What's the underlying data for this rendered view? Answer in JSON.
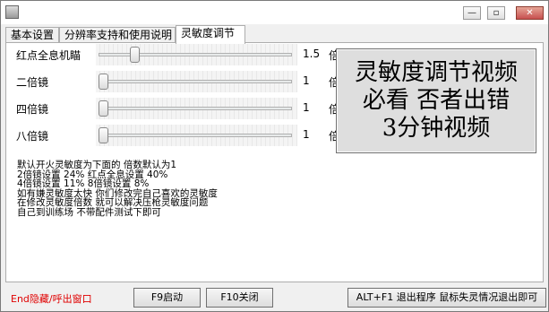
{
  "window": {
    "buttons": {
      "minimize": "—",
      "maximize": "▫",
      "close": "✕"
    }
  },
  "tabs": [
    "基本设置",
    "分辨率支持和使用说明",
    "灵敏度调节"
  ],
  "sliders": [
    {
      "label": "红点全息机瞄",
      "value": "1.5",
      "unit": "倍",
      "level": 0.17
    },
    {
      "label": "二倍镜",
      "value": "1",
      "unit": "倍",
      "level": 0
    },
    {
      "label": "四倍镜",
      "value": "1",
      "unit": "倍",
      "level": 0
    },
    {
      "label": "八倍镜",
      "value": "1",
      "unit": "倍",
      "level": 0
    }
  ],
  "video_button": {
    "line1": "灵敏度调节视频",
    "line2": "必看  否者出错",
    "line3": "3分钟视频"
  },
  "info": {
    "lines": [
      "默认开火灵敏度为下面的   倍数默认为1",
      "2倍镜设置 24%    红点全息设置  40%",
      "4倍镜设置 11%    8倍镜设置 8%",
      "如有嫌灵敏度太快 你们修改完自己喜欢的灵敏度",
      "在修改灵敏度倍数 就可以解决压枪灵敏度问题",
      "自己到训练场 不带配件测试下即可"
    ]
  },
  "footer": {
    "status": "End隐藏/呼出窗口",
    "f9": "F9启动",
    "f10": "F10关闭",
    "exit": "ALT+F1 退出程序 鼠标失灵情况退出即可"
  }
}
